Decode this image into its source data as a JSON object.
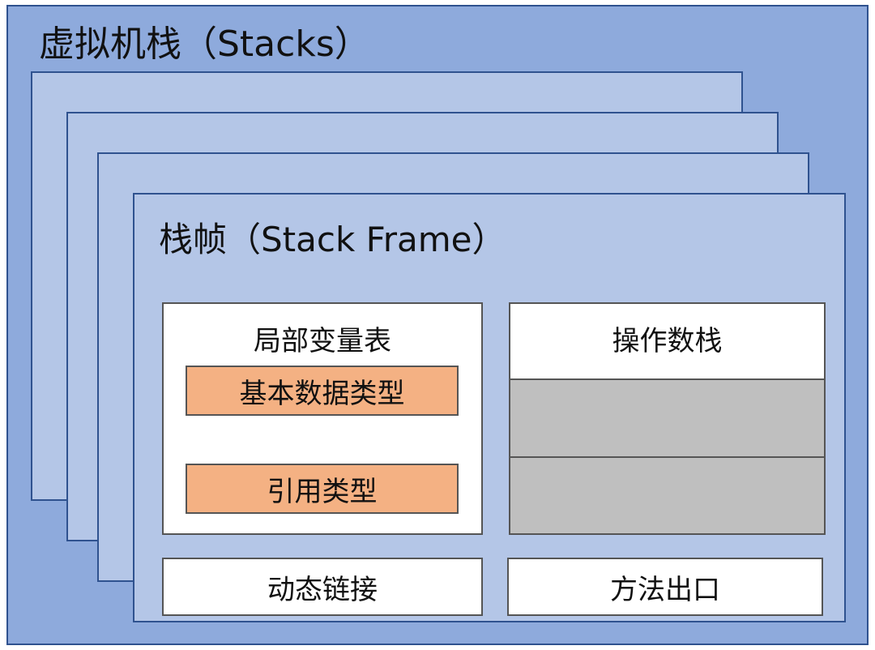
{
  "stacks": {
    "title": "虚拟机栈（Stacks）"
  },
  "frame": {
    "title": "栈帧（Stack Frame）",
    "local_variable_table": {
      "title": "局部变量表",
      "items": [
        "基本数据类型",
        "引用类型"
      ]
    },
    "operand_stack": {
      "title": "操作数栈"
    },
    "dynamic_linking": "动态链接",
    "method_exit": "方法出口"
  },
  "colors": {
    "stacks_background": "#8eaadc",
    "frame_background": "#b4c6e7",
    "border": "#2f528f",
    "type_item": "#f4b183",
    "operand_slot": "#bfbfbf"
  }
}
